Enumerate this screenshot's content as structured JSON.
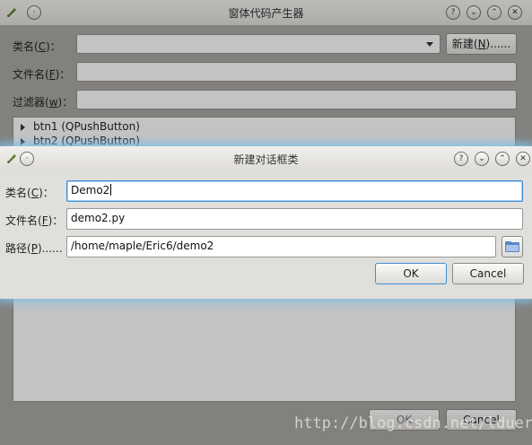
{
  "background_window": {
    "title": "窗体代码产生器",
    "class_label_pre": "类名(",
    "class_label_key": "C",
    "class_label_post": ")：",
    "class_value": "",
    "new_button_pre": "新建(",
    "new_button_key": "N",
    "new_button_post": ")......",
    "file_label_pre": "文件名(",
    "file_label_key": "F",
    "file_label_post": ")：",
    "filter_label_pre": "过滤器(",
    "filter_label_key": "w",
    "filter_label_post": ")：",
    "tree_items": [
      "btn1 (QPushButton)",
      "btn2 (QPushButton)"
    ],
    "ok_label": "OK",
    "cancel_label": "Cancel"
  },
  "dialog": {
    "title": "新建对话框类",
    "class_label_pre": "类名(",
    "class_label_key": "C",
    "class_label_post": ")：",
    "class_value": "Demo2",
    "file_label_pre": "文件名(",
    "file_label_key": "F",
    "file_label_post": ")：",
    "file_value": "demo2.py",
    "path_label_pre": "路径(",
    "path_label_key": "P",
    "path_label_post": ")......",
    "path_value": "/home/maple/Eric6/demo2",
    "ok_label": "OK",
    "cancel_label": "Cancel"
  },
  "titlebar_buttons": {
    "help": "?",
    "minimize": "⌄",
    "maximize": "⌃",
    "close": "✕"
  },
  "watermark": "http://blog.csdn.net/lduer"
}
